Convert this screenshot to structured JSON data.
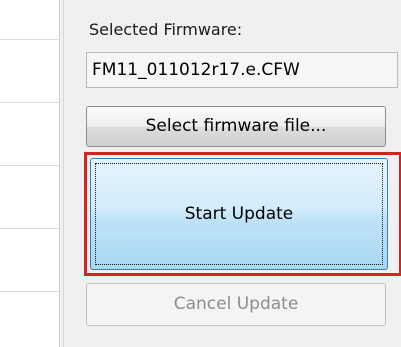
{
  "firmware_panel": {
    "selected_label": "Selected Firmware:",
    "selected_file": "FM11_011012r17.e.CFW",
    "select_button_label": "Select firmware file...",
    "start_button_label": "Start Update",
    "cancel_button_label": "Cancel Update",
    "cancel_enabled": false
  },
  "colors": {
    "highlight_border": "#d32424",
    "start_button_fill": "#bfe3f8",
    "disabled_text": "#8d8d8d"
  }
}
